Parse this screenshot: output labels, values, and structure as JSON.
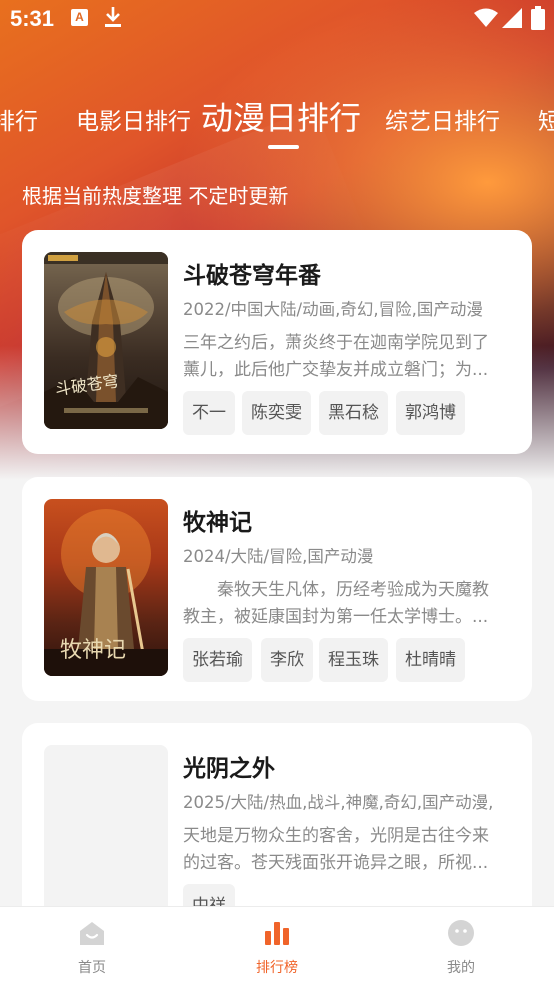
{
  "status_bar": {
    "time": "5:31",
    "a_icon_letter": "A"
  },
  "tabs": [
    {
      "label": "排行",
      "active": false
    },
    {
      "label": "电影日排行",
      "active": false
    },
    {
      "label": "动漫日排行",
      "active": true
    },
    {
      "label": "综艺日排行",
      "active": false
    },
    {
      "label": "短",
      "active": false
    }
  ],
  "subtitle": "根据当前热度整理 不定时更新",
  "cards": [
    {
      "title": "斗破苍穹年番",
      "meta": "2022/中国大陆/动画,奇幻,冒险,国产动漫",
      "desc_line1": "三年之约后，萧炎终于在迦南学院见到了",
      "desc_line2": "薰儿，此后他广交挚友并成立磐门；为...",
      "tags": [
        "不一",
        "陈奕雯",
        "黑石稔",
        "郭鸿博"
      ],
      "cover_text": "斗破苍穹"
    },
    {
      "title": "牧神记",
      "meta": "2024/大陆/冒险,国产动漫",
      "desc_line1": "　　秦牧天生凡体，历经考验成为天魔教",
      "desc_line2": "教主，被延康国封为第一任太学博士。...",
      "tags": [
        "张若瑜",
        "李欣",
        "程玉珠",
        "杜晴晴"
      ],
      "cover_text": "牧神记"
    },
    {
      "title": "光阴之外",
      "meta": "2025/大陆/热血,战斗,神魔,奇幻,国产动漫,",
      "desc_line1": "天地是万物众生的客舍，光阴是古往今来",
      "desc_line2": "的过客。苍天残面张开诡异之眼，所视...",
      "tags": [
        "中祥"
      ],
      "cover_text": ""
    }
  ],
  "bottom_nav": [
    {
      "label": "首页",
      "icon": "home-icon",
      "active": false
    },
    {
      "label": "排行榜",
      "icon": "ranking-bar-chart-icon",
      "active": true
    },
    {
      "label": "我的",
      "icon": "profile-face-icon",
      "active": false
    }
  ],
  "colors": {
    "accent": "#f0642a",
    "hero_top": "#e8701e",
    "hero_dark": "#2a0b1c"
  }
}
